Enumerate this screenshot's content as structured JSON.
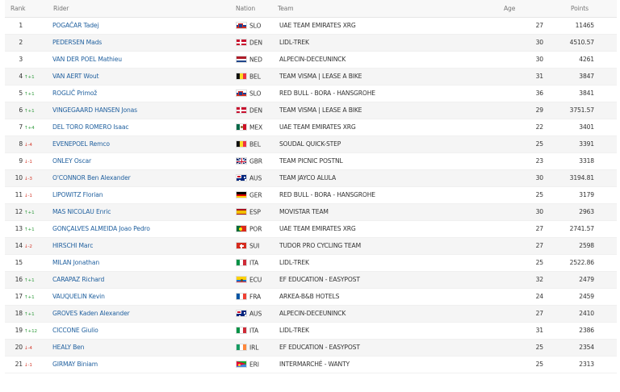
{
  "headers": {
    "rank": "Rank",
    "rider": "Rider",
    "nation": "Nation",
    "team": "Team",
    "age": "Age",
    "points": "Points"
  },
  "rows": [
    {
      "rank": "1",
      "delta": "",
      "dir": "none",
      "rider": "POGAČAR Tadej",
      "flag": "slo",
      "nation": "SLO",
      "team": "UAE TEAM EMIRATES XRG",
      "age": "27",
      "points": "11465"
    },
    {
      "rank": "2",
      "delta": "",
      "dir": "none",
      "rider": "PEDERSEN Mads",
      "flag": "den",
      "nation": "DEN",
      "team": "LIDL-TREK",
      "age": "30",
      "points": "4510.57"
    },
    {
      "rank": "3",
      "delta": "",
      "dir": "none",
      "rider": "VAN DER POEL Mathieu",
      "flag": "ned",
      "nation": "NED",
      "team": "ALPECIN-DECEUNINCK",
      "age": "30",
      "points": "4261"
    },
    {
      "rank": "4",
      "delta": "+1",
      "dir": "up",
      "rider": "VAN AERT Wout",
      "flag": "bel",
      "nation": "BEL",
      "team": "TEAM VISMA | LEASE A BIKE",
      "age": "31",
      "points": "3847"
    },
    {
      "rank": "5",
      "delta": "+1",
      "dir": "up",
      "rider": "ROGLIČ Primož",
      "flag": "slo",
      "nation": "SLO",
      "team": "RED BULL - BORA - HANSGROHE",
      "age": "36",
      "points": "3841"
    },
    {
      "rank": "6",
      "delta": "+1",
      "dir": "up",
      "rider": "VINGEGAARD HANSEN Jonas",
      "flag": "den",
      "nation": "DEN",
      "team": "TEAM VISMA | LEASE A BIKE",
      "age": "29",
      "points": "3751.57"
    },
    {
      "rank": "7",
      "delta": "+4",
      "dir": "up",
      "rider": "DEL TORO ROMERO Isaac",
      "flag": "mex",
      "nation": "MEX",
      "team": "UAE TEAM EMIRATES XRG",
      "age": "22",
      "points": "3401"
    },
    {
      "rank": "8",
      "delta": "-4",
      "dir": "down",
      "rider": "EVENEPOEL Remco",
      "flag": "bel",
      "nation": "BEL",
      "team": "SOUDAL QUICK-STEP",
      "age": "25",
      "points": "3391"
    },
    {
      "rank": "9",
      "delta": "-1",
      "dir": "down",
      "rider": "ONLEY Oscar",
      "flag": "gbr",
      "nation": "GBR",
      "team": "TEAM PICNIC POSTNL",
      "age": "23",
      "points": "3318"
    },
    {
      "rank": "10",
      "delta": "-3",
      "dir": "down",
      "rider": "O'CONNOR Ben Alexander",
      "flag": "aus",
      "nation": "AUS",
      "team": "TEAM JAYCO ALULA",
      "age": "30",
      "points": "3194.81"
    },
    {
      "rank": "11",
      "delta": "-1",
      "dir": "down",
      "rider": "LIPOWITZ Florian",
      "flag": "ger",
      "nation": "GER",
      "team": "RED BULL - BORA - HANSGROHE",
      "age": "25",
      "points": "3179"
    },
    {
      "rank": "12",
      "delta": "+1",
      "dir": "up",
      "rider": "MAS NICOLAU Enric",
      "flag": "esp",
      "nation": "ESP",
      "team": "MOVISTAR TEAM",
      "age": "30",
      "points": "2963"
    },
    {
      "rank": "13",
      "delta": "+1",
      "dir": "up",
      "rider": "GONÇALVES ALMEIDA Joao Pedro",
      "flag": "por",
      "nation": "POR",
      "team": "UAE TEAM EMIRATES XRG",
      "age": "27",
      "points": "2741.57"
    },
    {
      "rank": "14",
      "delta": "-2",
      "dir": "down",
      "rider": "HIRSCHI Marc",
      "flag": "sui",
      "nation": "SUI",
      "team": "TUDOR PRO CYCLING TEAM",
      "age": "27",
      "points": "2598"
    },
    {
      "rank": "15",
      "delta": "",
      "dir": "none",
      "rider": "MILAN Jonathan",
      "flag": "ita",
      "nation": "ITA",
      "team": "LIDL-TREK",
      "age": "25",
      "points": "2522.86"
    },
    {
      "rank": "16",
      "delta": "+1",
      "dir": "up",
      "rider": "CARAPAZ Richard",
      "flag": "ecu",
      "nation": "ECU",
      "team": "EF EDUCATION - EASYPOST",
      "age": "32",
      "points": "2479"
    },
    {
      "rank": "17",
      "delta": "+1",
      "dir": "up",
      "rider": "VAUQUELIN Kevin",
      "flag": "fra",
      "nation": "FRA",
      "team": "ARKEA-B&B HOTELS",
      "age": "24",
      "points": "2459"
    },
    {
      "rank": "18",
      "delta": "+1",
      "dir": "up",
      "rider": "GROVES Kaden Alexander",
      "flag": "aus",
      "nation": "AUS",
      "team": "ALPECIN-DECEUNINCK",
      "age": "27",
      "points": "2410"
    },
    {
      "rank": "19",
      "delta": "+12",
      "dir": "up",
      "rider": "CICCONE Giulio",
      "flag": "ita",
      "nation": "ITA",
      "team": "LIDL-TREK",
      "age": "31",
      "points": "2386"
    },
    {
      "rank": "20",
      "delta": "-4",
      "dir": "down",
      "rider": "HEALY Ben",
      "flag": "irl",
      "nation": "IRL",
      "team": "EF EDUCATION - EASYPOST",
      "age": "25",
      "points": "2354"
    },
    {
      "rank": "21",
      "delta": "-1",
      "dir": "down",
      "rider": "GIRMAY Biniam",
      "flag": "eri",
      "nation": "ERI",
      "team": "INTERMARCHÉ - WANTY",
      "age": "25",
      "points": "2313"
    }
  ],
  "arrows": {
    "up": "↑",
    "down": "↓"
  }
}
